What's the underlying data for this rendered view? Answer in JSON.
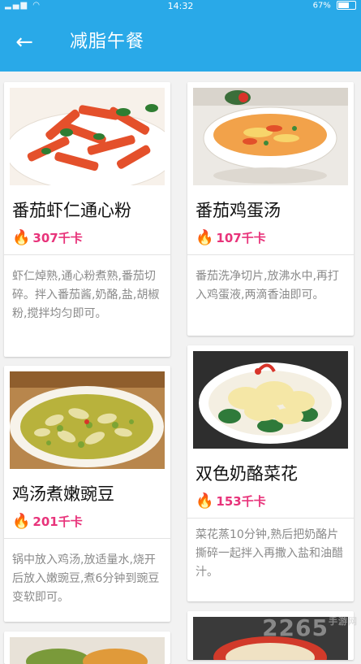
{
  "status_bar": {
    "time": "14:32",
    "battery": "67%"
  },
  "header": {
    "back_icon": "arrow-left-icon",
    "title": "减脂午餐"
  },
  "colors": {
    "primary": "#29a9e8",
    "calorie": "#e8337a",
    "flame": "#f08a18"
  },
  "recipes": [
    {
      "name": "番茄虾仁通心粉",
      "calories": "307千卡",
      "description": "虾仁焯熟,通心粉煮熟,番茄切碎。拌入番茄酱,奶酪,盐,胡椒粉,搅拌均匀即可。"
    },
    {
      "name": "番茄鸡蛋汤",
      "calories": "107千卡",
      "description": "番茄洗净切片,放沸水中,再打入鸡蛋液,两滴香油即可。"
    },
    {
      "name": "鸡汤煮嫩豌豆",
      "calories": "201千卡",
      "description": "锅中放入鸡汤,放适量水,烧开后放入嫩豌豆,煮6分钟到豌豆变软即可。"
    },
    {
      "name": "双色奶酪菜花",
      "calories": "153千卡",
      "description": "菜花蒸10分钟,熟后把奶酪片撕碎一起拌入再撒入盐和油醋汁。"
    }
  ],
  "watermark": {
    "text": "2265",
    "suffix": "手游网"
  }
}
